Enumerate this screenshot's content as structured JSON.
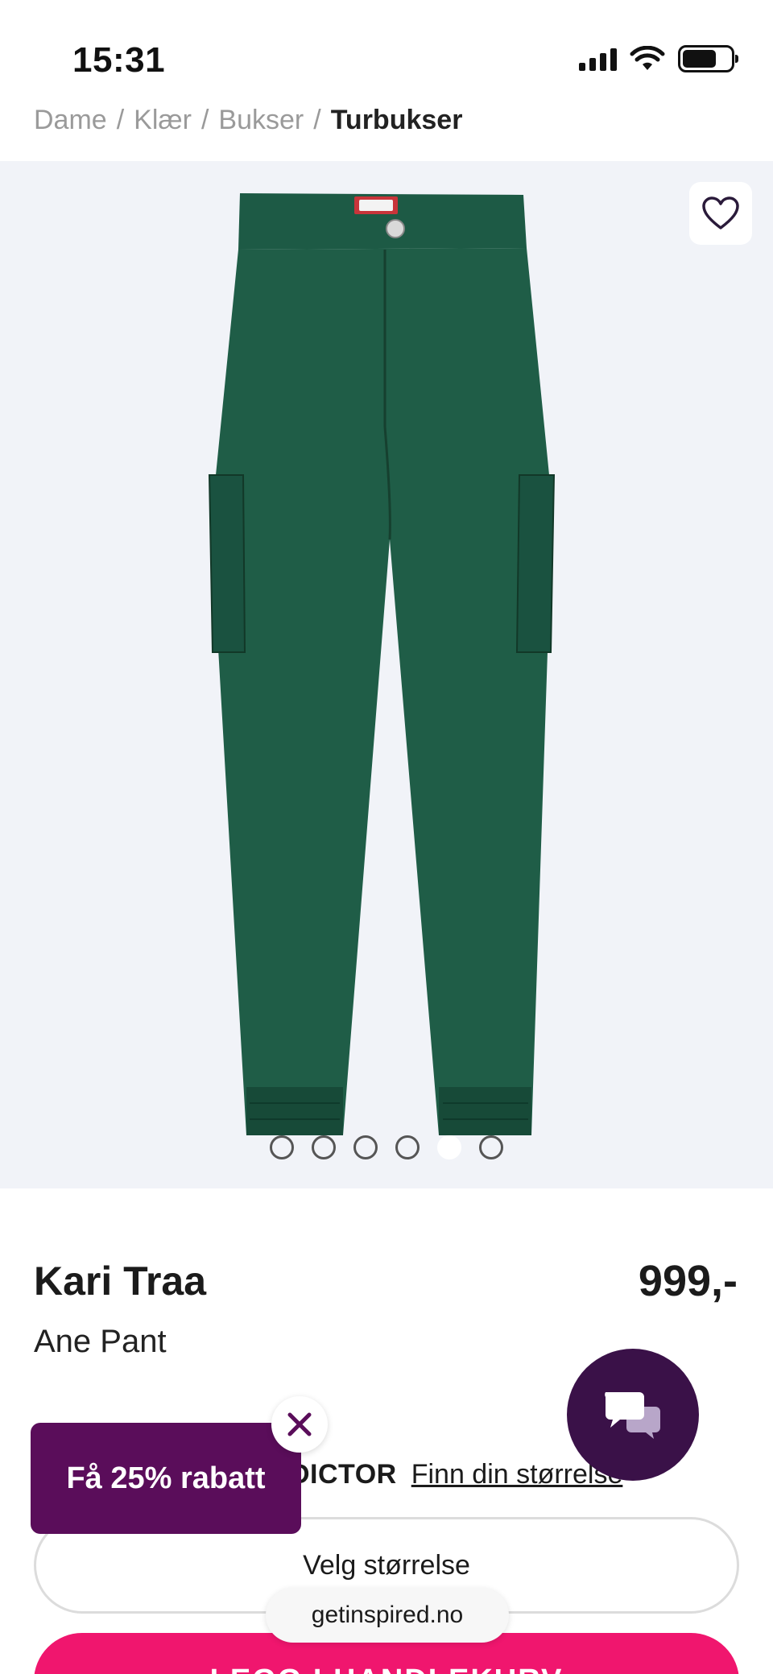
{
  "status_bar": {
    "time": "15:31",
    "icons": [
      "signal-icon",
      "wifi-icon",
      "battery-icon"
    ]
  },
  "breadcrumb": {
    "items": [
      "Dame",
      "Klær",
      "Bukser"
    ],
    "separator": "/",
    "current": "Turbukser"
  },
  "gallery": {
    "image_subject": "green cargo pants",
    "slide_count": 6,
    "active_slide": 5,
    "favorite_icon": "heart-icon"
  },
  "product": {
    "brand": "Kari Traa",
    "name": "Ane Pant",
    "price": "999,-"
  },
  "size_predictor": {
    "label": "DICTOR",
    "link": "Finn din størrelse"
  },
  "size_select": {
    "placeholder": "Velg størrelse"
  },
  "cart": {
    "label": "LEGG I HANDLEKURV"
  },
  "browser": {
    "url": "getinspired.no"
  },
  "popup": {
    "discount_label": "Få 25% rabatt",
    "close_icon": "close-icon"
  },
  "chat": {
    "icon": "chat-bubbles-icon"
  },
  "colors": {
    "brand_purple": "#5a0d5a",
    "chat_purple": "#3a1148",
    "cta_pink": "#f0166e",
    "gallery_bg": "#f1f3f8",
    "product_green": "#1e5a44"
  }
}
